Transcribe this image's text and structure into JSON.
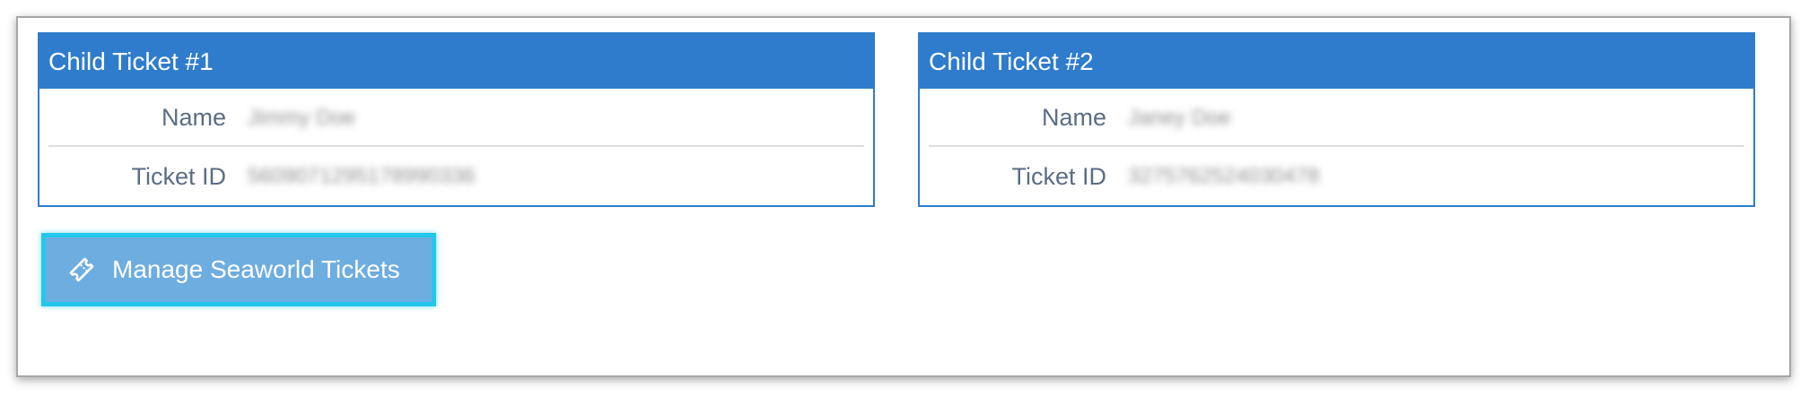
{
  "cards": [
    {
      "title": "Child Ticket #1",
      "fields": [
        {
          "label": "Name",
          "value": "Jimmy Doe"
        },
        {
          "label": "Ticket ID",
          "value": "5609071295178990336"
        }
      ]
    },
    {
      "title": "Child Ticket #2",
      "fields": [
        {
          "label": "Name",
          "value": "Janey Doe"
        },
        {
          "label": "Ticket ID",
          "value": "3275762524030478"
        }
      ]
    }
  ],
  "actions": {
    "manage_label": "Manage Seaworld Tickets",
    "manage_icon": "ticket-icon"
  },
  "colors": {
    "header_blue": "#2f7ccc",
    "button_fill": "#6eade0",
    "button_highlight": "#22c7ea",
    "label_text": "#5a6e84"
  }
}
